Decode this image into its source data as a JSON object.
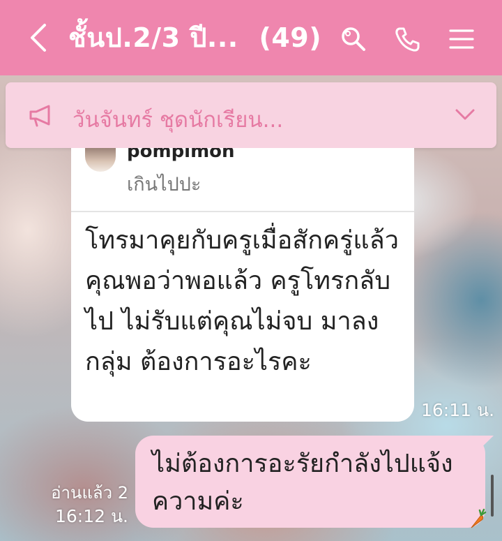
{
  "header": {
    "title": "ชั้นป.2/3 ปี...",
    "member_count": "(49)",
    "back_icon": "chevron-left-icon",
    "search_icon": "search-icon",
    "call_icon": "phone-icon",
    "menu_icon": "menu-icon",
    "background": "#ef86ae"
  },
  "announcement": {
    "text": "วันจันทร์ ชุดนักเรียน...",
    "icon": "megaphone-icon",
    "expand_icon": "chevron-down-icon"
  },
  "messages": [
    {
      "direction": "incoming",
      "reply_to": {
        "name": "pompimon",
        "text": "เกินไปปะ"
      },
      "text": "โทรมาคุยกับครูเมื่อสักครู่แล้ว คุณพอว่าพอแล้ว ครูโทรกลับไป ไม่รับแต่คุณไม่จบ มาลงกลุ่ม ต้องการอะไรคะ",
      "time": "16:11 น."
    },
    {
      "direction": "outgoing",
      "text": "ไม่ต้องการอะรัยกำลังไปแจ้งความค่ะ",
      "read": "อ่านแล้ว 2",
      "time": "16:12 น."
    }
  ],
  "colors": {
    "accent": "#ef86ae",
    "outgoing_bubble": "#f9d2e2",
    "incoming_bubble": "#ffffff"
  }
}
